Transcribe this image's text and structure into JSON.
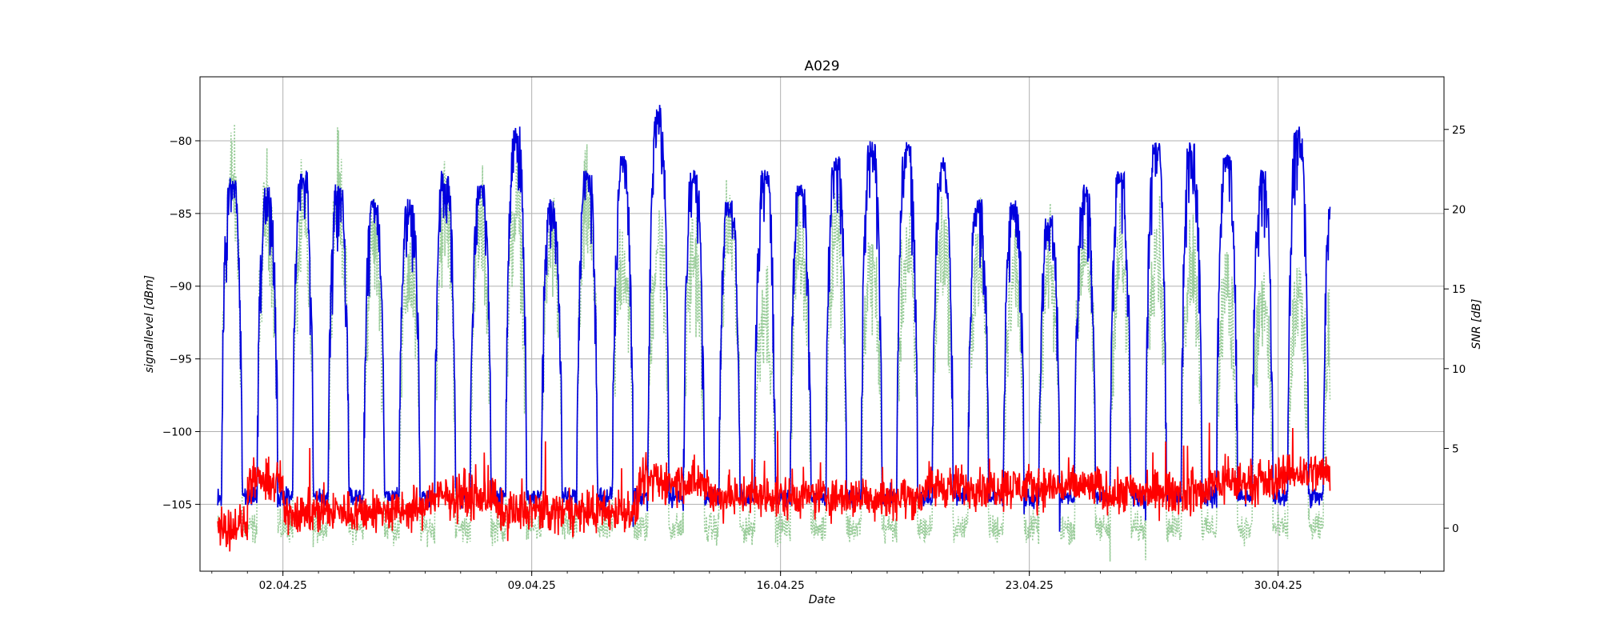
{
  "chart_data": {
    "type": "line",
    "title": "A029",
    "xlabel": "Date",
    "ylabel_left": "signallevel [dBm]",
    "ylabel_right": "SNR [dB]",
    "x_domain": [
      "2025-03-30T16:00",
      "2025-05-04T16:00"
    ],
    "x_data_range": [
      "2025-03-31T04:00",
      "2025-05-01T11:00"
    ],
    "x_ticks": [
      {
        "date": "2025-04-02",
        "label": "02.04.25"
      },
      {
        "date": "2025-04-09",
        "label": "09.04.25"
      },
      {
        "date": "2025-04-16",
        "label": "16.04.25"
      },
      {
        "date": "2025-04-23",
        "label": "23.04.25"
      },
      {
        "date": "2025-04-30",
        "label": "30.04.25"
      }
    ],
    "x_minor_tick_step_days": 1,
    "ylim_left": [
      -109.6,
      -75.6
    ],
    "yticks_left": [
      -80,
      -85,
      -90,
      -95,
      -100,
      -105
    ],
    "ylim_right": [
      -2.7,
      28.3
    ],
    "yticks_right": [
      25,
      20,
      15,
      10,
      5,
      0
    ],
    "grid": true,
    "series": [
      {
        "axis": "left",
        "color": "#0000dd",
        "style": "solid",
        "baseline": -104.5,
        "daily_peaks": [
          -82.5,
          -83,
          -82,
          -83,
          -84,
          -84,
          -82,
          -83,
          -79,
          -84,
          -82,
          -81,
          -77.5,
          -82,
          -84,
          -82,
          -83,
          -81,
          -80,
          -80,
          -81,
          -84,
          -84,
          -85,
          -83,
          -82,
          -80,
          -80,
          -81,
          -82,
          -79,
          -82
        ]
      },
      {
        "axis": "left",
        "color": "#ff0000",
        "style": "solid",
        "segments": [
          {
            "from": "2025-03-31",
            "mean": -106.5
          },
          {
            "from": "2025-04-01",
            "mean": -103.5
          },
          {
            "from": "2025-04-02",
            "mean": -105.5
          },
          {
            "from": "2025-04-06",
            "mean": -104.5
          },
          {
            "from": "2025-04-08",
            "mean": -105.5
          },
          {
            "from": "2025-04-12",
            "mean": -103.5
          },
          {
            "from": "2025-04-14",
            "mean": -104.5
          },
          {
            "from": "2025-04-20",
            "mean": -103.8
          },
          {
            "from": "2025-04-25",
            "mean": -104.2
          },
          {
            "from": "2025-04-28",
            "mean": -103.5
          },
          {
            "from": "2025-04-30",
            "mean": -102.8
          }
        ],
        "peak": -99
      },
      {
        "axis": "right",
        "color": "#99cc99",
        "style": "dotted",
        "baseline": 0,
        "daily_peaks": [
          25,
          23,
          22,
          24,
          21,
          19,
          23,
          22,
          23,
          21,
          23,
          20,
          21,
          20,
          22,
          17,
          21,
          22,
          19,
          20,
          21,
          20,
          19,
          19,
          21,
          20,
          21,
          20,
          18,
          17,
          17,
          16
        ]
      }
    ]
  }
}
